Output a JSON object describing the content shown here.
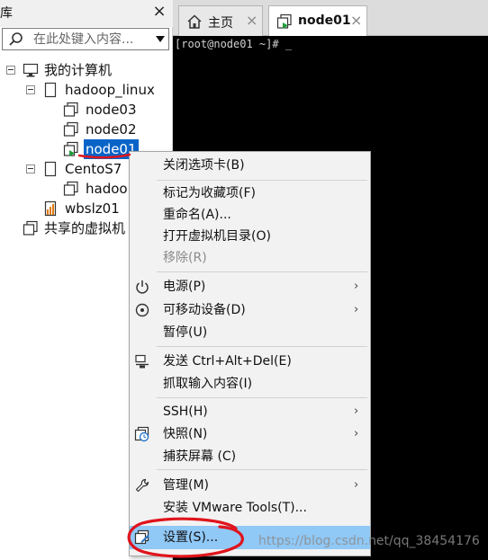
{
  "library": {
    "title": "库",
    "close": "×",
    "search": {
      "placeholder": "在此处键入内容..."
    },
    "tree": {
      "root": "我的计算机",
      "group1": "hadoop_linux",
      "vm1": "node03",
      "vm2": "node02",
      "vm3": "node01",
      "group2": "CentoS7",
      "vm4": "hadoo",
      "vm5": "wbslz01",
      "shared": "共享的虚拟机"
    }
  },
  "tabs": {
    "home": {
      "label": "主页",
      "close": "×"
    },
    "node": {
      "label": "node01",
      "close": "×"
    }
  },
  "terminal": {
    "line": "[root@node01 ~]# _"
  },
  "menu": {
    "close_tab": "关闭选项卡(B)",
    "favorite": "标记为收藏项(F)",
    "rename": "重命名(A)...",
    "open_dir": "打开虚拟机目录(O)",
    "remove": "移除(R)",
    "power": "电源(P)",
    "removable": "可移动设备(D)",
    "pause": "暂停(U)",
    "send_cad": "发送 Ctrl+Alt+Del(E)",
    "grab_input": "抓取输入内容(I)",
    "ssh": "SSH(H)",
    "snapshot": "快照(N)",
    "capture": "捕获屏幕 (C)",
    "manage": "管理(M)",
    "install_tools": "安装 VMware Tools(T)...",
    "settings": "设置(S)...",
    "submenu_arrow": "›"
  },
  "watermark": "https://blog.csdn.net/qq_38454176",
  "colors": {
    "selection": "#0a64c8",
    "hover": "#90c8f6",
    "annotation": "#e0141c",
    "terminal_bg": "#000000"
  }
}
